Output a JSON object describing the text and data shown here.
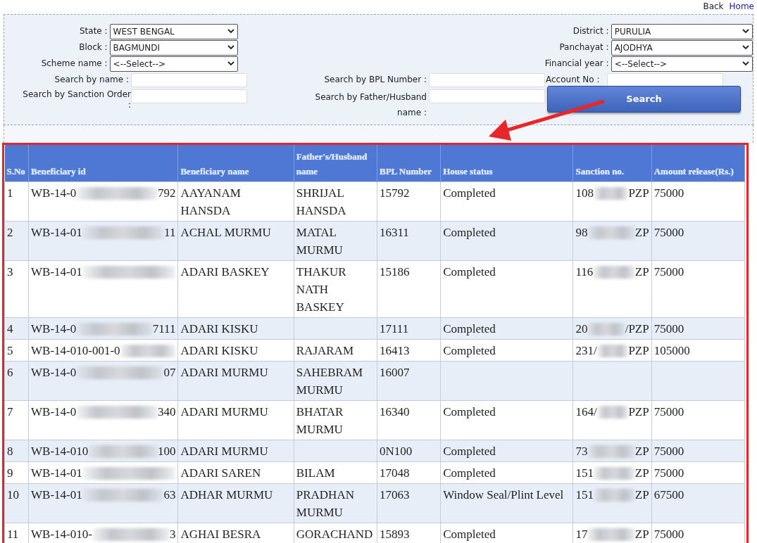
{
  "top_links": [
    {
      "label": "Back",
      "kind": "plain"
    },
    {
      "label": "Home",
      "kind": "link"
    }
  ],
  "filters_top": [
    {
      "label": "State :",
      "value": "WEST BENGAL"
    },
    {
      "label": "District :",
      "value": "PURULIA"
    },
    {
      "label": "Block :",
      "value": "BAGMUNDI"
    },
    {
      "label": "Panchayat :",
      "value": "AJODHYA"
    },
    {
      "label": "Scheme name :",
      "value": "<--Select-->"
    },
    {
      "label": "Financial year :",
      "value": "<--Select-->"
    }
  ],
  "search_fields": [
    {
      "label": "Search by name :"
    },
    {
      "label": "Search by BPL Number :"
    },
    {
      "label": "Account No :"
    },
    {
      "label": "Search by Sanction Order :"
    },
    {
      "label": "Search by Father/Husband name :"
    }
  ],
  "search_button": "Search",
  "table": {
    "columns": [
      "S.No",
      "Beneficiary id",
      "Beneficiary name",
      "Father's/Husband name",
      "BPL Number",
      "House status",
      "Sanction no.",
      "Amount release(Rs.)"
    ],
    "rows": [
      {
        "sno": "1",
        "id": {
          "start": "WB-14-0",
          "end": "792",
          "blurred": true
        },
        "name": "AAYANAM HANSDA",
        "father": "SHRIJAL HANSDA",
        "bpl": "15792",
        "status": "Completed",
        "sanction": {
          "start": "108",
          "end": "PZP",
          "blurred": true
        },
        "amount": "75000"
      },
      {
        "sno": "2",
        "id": {
          "start": "WB-14-01",
          "end": "11",
          "blurred": true
        },
        "name": "ACHAL MURMU",
        "father": "MATAL MURMU",
        "bpl": "16311",
        "status": "Completed",
        "sanction": {
          "start": "98",
          "end": "ZP",
          "blurred": true
        },
        "amount": "75000"
      },
      {
        "sno": "3",
        "id": {
          "start": "WB-14-01",
          "blurred": true
        },
        "name": "ADARI BASKEY",
        "father": "THAKUR NATH BASKEY",
        "bpl": "15186",
        "status": "Completed",
        "sanction": {
          "start": "116",
          "end": "ZP",
          "blurred": true
        },
        "amount": "75000"
      },
      {
        "sno": "4",
        "id": {
          "start": "WB-14-0",
          "end": "7111",
          "blurred": true
        },
        "name": "ADARI KISKU",
        "bpl": "17111",
        "status": "Completed",
        "sanction": {
          "start": "20",
          "end": "/PZP",
          "blurred": true
        },
        "amount": "75000"
      },
      {
        "sno": "5",
        "id": {
          "start": "WB-14-010-001-0",
          "blurred": true
        },
        "name": "ADARI KISKU",
        "father": "RAJARAM",
        "bpl": "16413",
        "status": "Completed",
        "sanction": {
          "start": "231/",
          "end": "PZP",
          "blurred": true
        },
        "amount": "105000"
      },
      {
        "sno": "6",
        "id": {
          "start": "WB-14-0",
          "end": "07",
          "blurred": true
        },
        "name": "ADARI MURMU",
        "father": "SAHEBRAM MURMU",
        "bpl": "16007"
      },
      {
        "sno": "7",
        "id": {
          "start": "WB-14-0",
          "end": "340",
          "blurred": true
        },
        "name": "ADARI MURMU",
        "father": "BHATAR MURMU",
        "bpl": "16340",
        "status": "Completed",
        "sanction": {
          "start": "164/",
          "end": "PZP",
          "blurred": true
        },
        "amount": "75000"
      },
      {
        "sno": "8",
        "id": {
          "start": "WB-14-010",
          "end": "100",
          "blurred": true
        },
        "name": "ADARI MURMU",
        "bpl": "0N100",
        "status": "Completed",
        "sanction": {
          "start": "73",
          "end": "ZP",
          "blurred": true
        },
        "amount": "75000"
      },
      {
        "sno": "9",
        "id": {
          "start": "WB-14-01",
          "blurred": true
        },
        "name": "ADARI SAREN",
        "father": "BILAM",
        "bpl": "17048",
        "status": "Completed",
        "sanction": {
          "start": "151",
          "end": "ZP",
          "blurred": true
        },
        "amount": "75000"
      },
      {
        "sno": "10",
        "id": {
          "start": "WB-14-01",
          "end": "63",
          "blurred": true
        },
        "name": "ADHAR MURMU",
        "father": "PRADHAN MURMU",
        "bpl": "17063",
        "status": "Window Seal/Plint Level",
        "sanction": {
          "start": "151",
          "end": "ZP",
          "blurred": true
        },
        "amount": "67500"
      },
      {
        "sno": "11",
        "id": {
          "start": "WB-14-010-",
          "end": "3",
          "blurred": true
        },
        "name": "AGHAI BESRA",
        "father": "GORACHAND",
        "bpl": "15893",
        "status": "Completed",
        "sanction": {
          "start": "17",
          "end": "ZP",
          "blurred": true
        },
        "amount": "75000"
      }
    ]
  }
}
